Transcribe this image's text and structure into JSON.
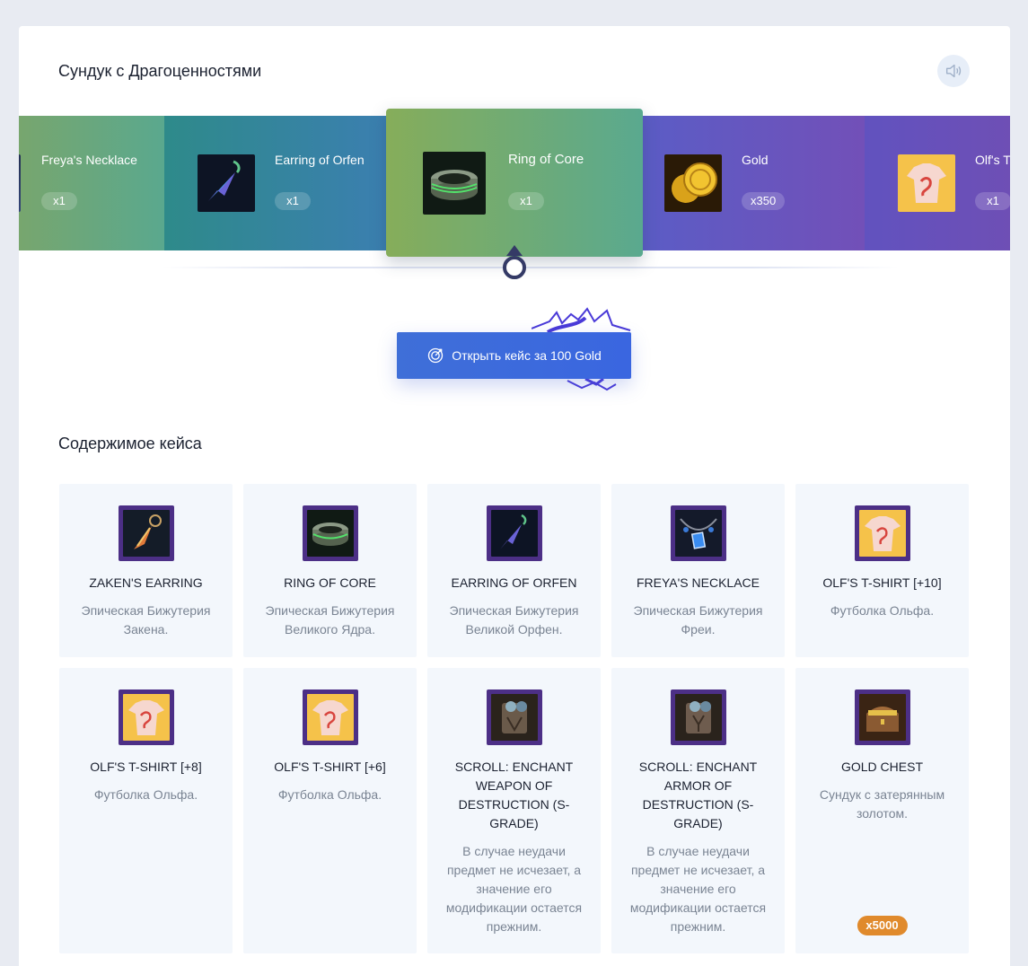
{
  "header": {
    "title": "Сундук с Драгоценностями",
    "sound_icon": "speaker-icon"
  },
  "roulette": {
    "items": [
      {
        "name": "Freya's Necklace",
        "qty": "x1",
        "icon": "necklace-icon"
      },
      {
        "name": "Earring of Orfen",
        "qty": "x1",
        "icon": "earring-icon"
      },
      {
        "name": "Ring of Core",
        "qty": "x1",
        "icon": "ring-icon"
      },
      {
        "name": "Gold",
        "qty": "x350",
        "icon": "gold-coins-icon"
      },
      {
        "name": "Olf's T",
        "qty": "x1",
        "icon": "tshirt-icon"
      }
    ]
  },
  "open_button": {
    "label": "Открыть кейс за 100 Gold",
    "icon": "target-icon"
  },
  "contents": {
    "title": "Содержимое кейса",
    "items": [
      {
        "name": "ZAKEN'S EARRING",
        "desc": "Эпическая Бижутерия Закена.",
        "icon": "earring-icon"
      },
      {
        "name": "RING OF CORE",
        "desc": "Эпическая Бижутерия Великого Ядра.",
        "icon": "ring-icon"
      },
      {
        "name": "EARRING OF ORFEN",
        "desc": "Эпическая Бижутерия Великой Орфен.",
        "icon": "earring-icon"
      },
      {
        "name": "FREYA'S NECKLACE",
        "desc": "Эпическая Бижутерия Фреи.",
        "icon": "necklace-icon"
      },
      {
        "name": "OLF'S T-SHIRT [+10]",
        "desc": "Футболка Ольфа.",
        "icon": "tshirt-icon"
      },
      {
        "name": "OLF'S T-SHIRT [+8]",
        "desc": "Футболка Ольфа.",
        "icon": "tshirt-icon"
      },
      {
        "name": "OLF'S T-SHIRT [+6]",
        "desc": "Футболка Ольфа.",
        "icon": "tshirt-icon"
      },
      {
        "name": "SCROLL: ENCHANT WEAPON OF DESTRUCTION (S-GRADE)",
        "desc": "В случае неудачи предмет не исчезает, а значение его модификации остается прежним.",
        "icon": "scroll-icon"
      },
      {
        "name": "SCROLL: ENCHANT ARMOR OF DESTRUCTION (S-GRADE)",
        "desc": "В случае неудачи предмет не исчезает, а значение его модификации остается прежним.",
        "icon": "scroll-icon"
      },
      {
        "name": "GOLD CHEST",
        "desc": "Сундук с затерянным золотом.",
        "badge": "x5000",
        "icon": "chest-icon"
      }
    ]
  },
  "colors": {
    "accent_blue": "#3f6fd8",
    "tile_frame": "#4c2f86",
    "badge_orange": "#e08a2c"
  }
}
